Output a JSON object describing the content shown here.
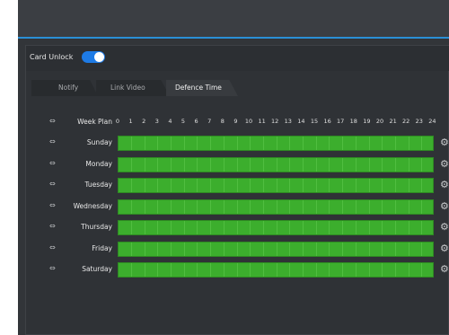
{
  "card_unlock": {
    "label": "Card Unlock",
    "enabled": true
  },
  "tabs": [
    {
      "label": "Notify"
    },
    {
      "label": "Link Video"
    },
    {
      "label": "Defence Time",
      "active": true
    }
  ],
  "week_plan": {
    "header_label": "Week Plan",
    "hours": [
      "0",
      "1",
      "2",
      "3",
      "4",
      "5",
      "6",
      "7",
      "8",
      "9",
      "10",
      "11",
      "12",
      "13",
      "14",
      "15",
      "16",
      "17",
      "18",
      "19",
      "20",
      "21",
      "22",
      "23",
      "24"
    ],
    "days": [
      {
        "label": "Sunday",
        "armed_fraction": 1.0
      },
      {
        "label": "Monday",
        "armed_fraction": 1.0
      },
      {
        "label": "Tuesday",
        "armed_fraction": 1.0
      },
      {
        "label": "Wednesday",
        "armed_fraction": 1.0
      },
      {
        "label": "Thursday",
        "armed_fraction": 1.0
      },
      {
        "label": "Friday",
        "armed_fraction": 1.0
      },
      {
        "label": "Saturday",
        "armed_fraction": 1.0
      }
    ],
    "link_icon": "link-icon",
    "settings_icon": "gear-icon",
    "armed_color": "#3cae2d"
  },
  "colors": {
    "accent": "#1e7be6",
    "topbar_line": "#2a8fd6"
  }
}
